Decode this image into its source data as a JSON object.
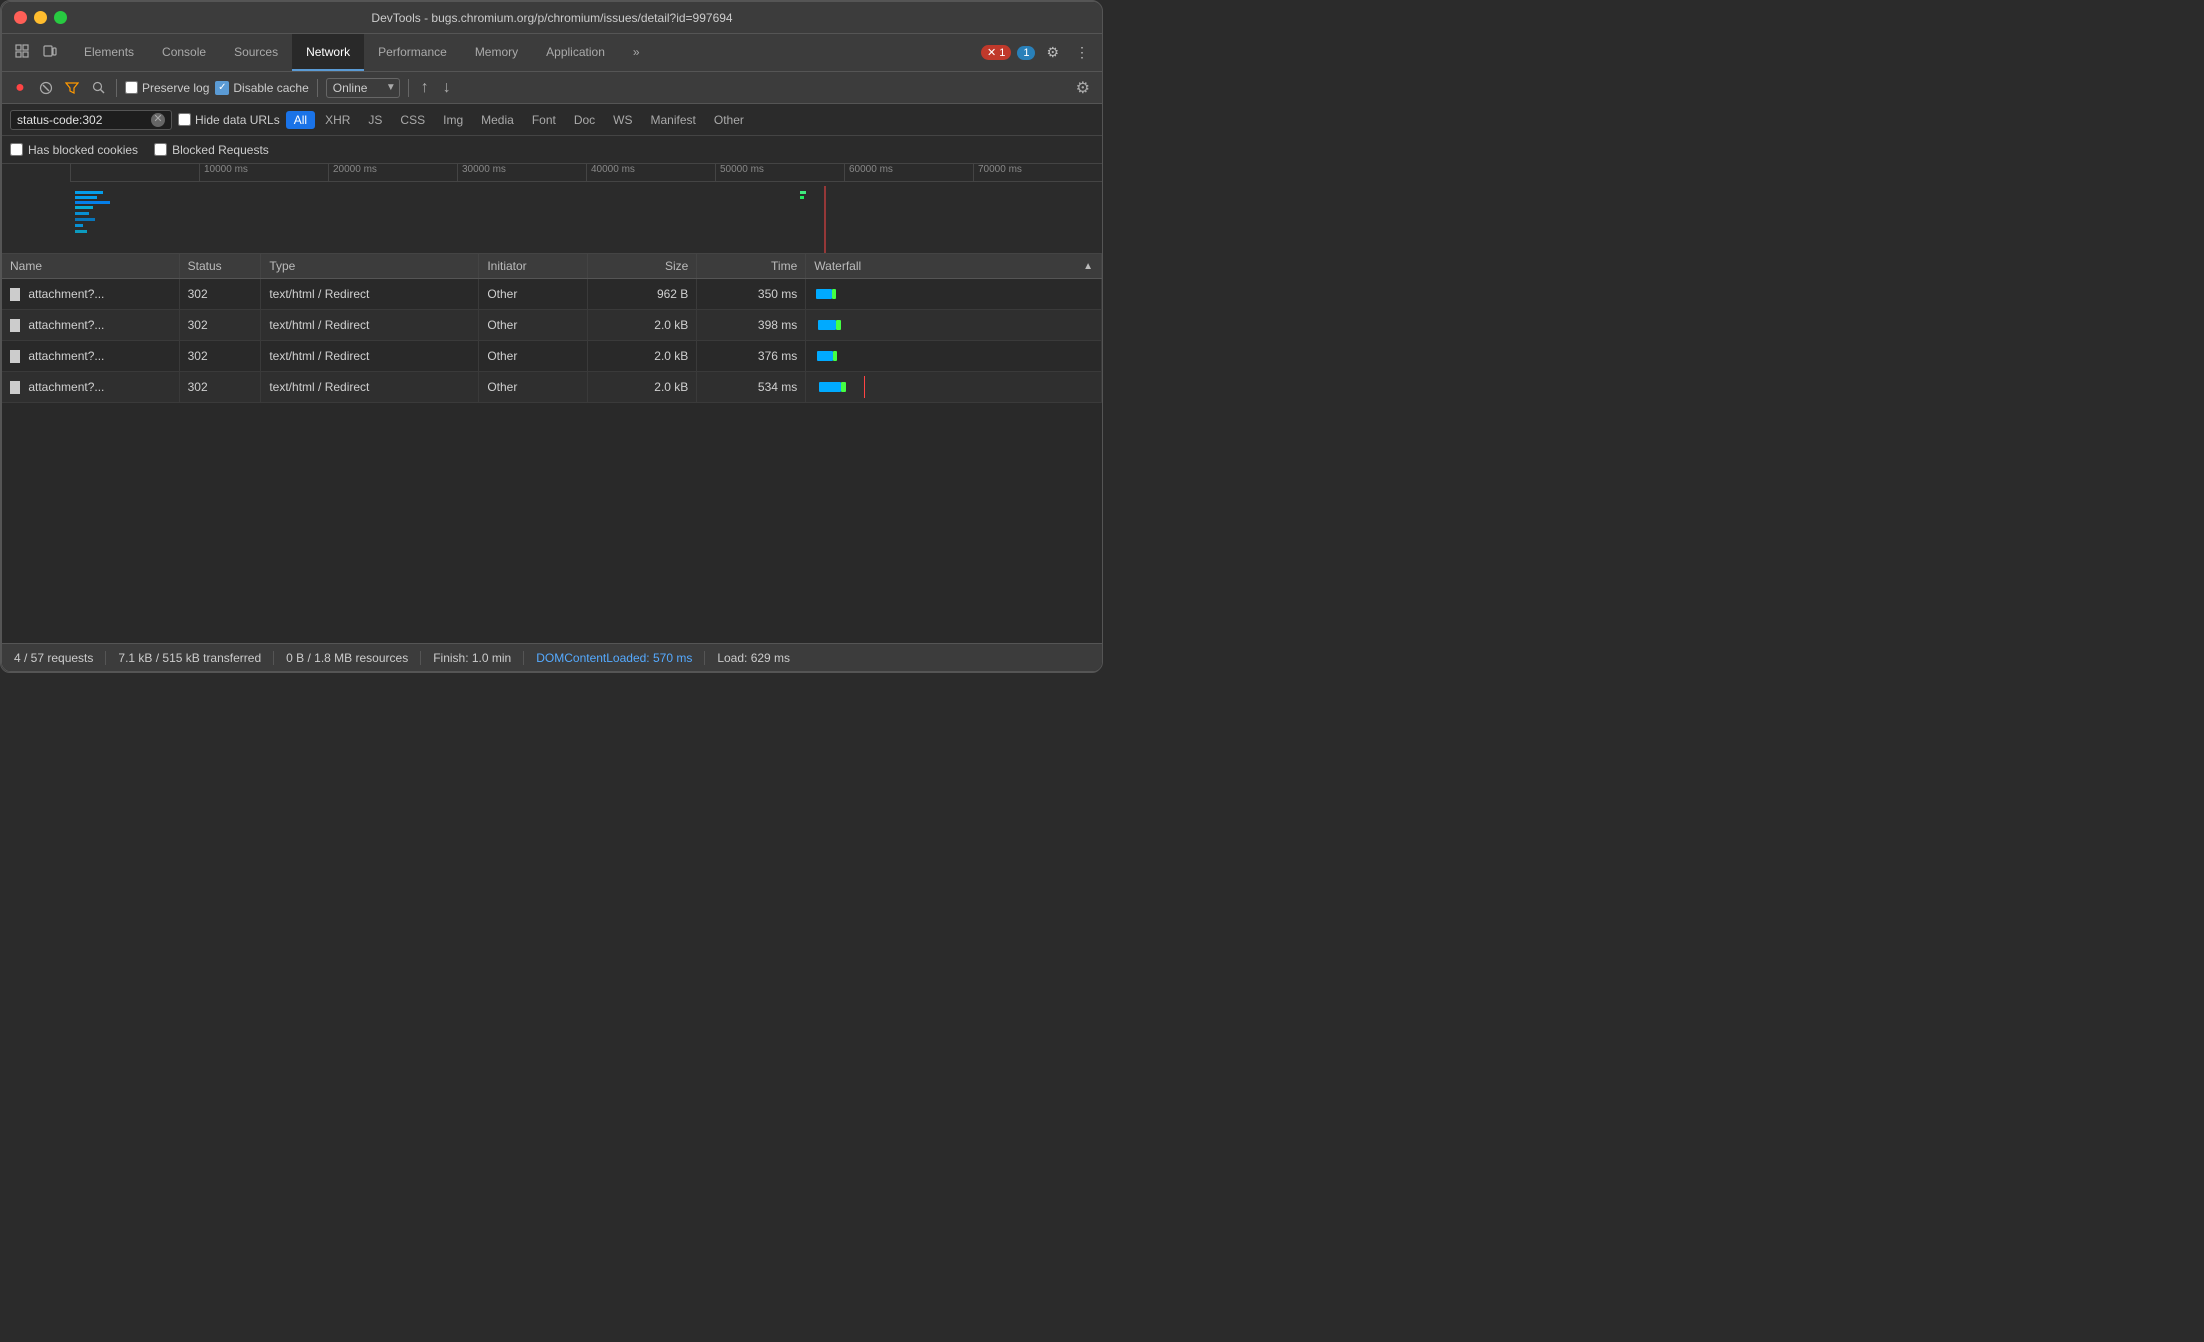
{
  "window": {
    "title": "DevTools - bugs.chromium.org/p/chromium/issues/detail?id=997694"
  },
  "tabs": {
    "items": [
      {
        "label": "Elements",
        "active": false
      },
      {
        "label": "Console",
        "active": false
      },
      {
        "label": "Sources",
        "active": false
      },
      {
        "label": "Network",
        "active": true
      },
      {
        "label": "Performance",
        "active": false
      },
      {
        "label": "Memory",
        "active": false
      },
      {
        "label": "Application",
        "active": false
      }
    ],
    "more": "»",
    "error_count": "1",
    "warning_count": "1"
  },
  "toolbar": {
    "preserve_log": "Preserve log",
    "disable_cache": "Disable cache",
    "online_label": "Online"
  },
  "filter": {
    "value": "status-code:302",
    "hide_data_urls": "Hide data URLs",
    "types": [
      {
        "label": "All",
        "active": true
      },
      {
        "label": "XHR",
        "active": false
      },
      {
        "label": "JS",
        "active": false
      },
      {
        "label": "CSS",
        "active": false
      },
      {
        "label": "Img",
        "active": false
      },
      {
        "label": "Media",
        "active": false
      },
      {
        "label": "Font",
        "active": false
      },
      {
        "label": "Doc",
        "active": false
      },
      {
        "label": "WS",
        "active": false
      },
      {
        "label": "Manifest",
        "active": false
      },
      {
        "label": "Other",
        "active": false
      }
    ]
  },
  "checkboxes": {
    "blocked_cookies": "Has blocked cookies",
    "blocked_requests": "Blocked Requests"
  },
  "timeline": {
    "marks": [
      "10000 ms",
      "20000 ms",
      "30000 ms",
      "40000 ms",
      "50000 ms",
      "60000 ms",
      "70000 ms"
    ]
  },
  "table": {
    "headers": [
      "Name",
      "Status",
      "Type",
      "Initiator",
      "Size",
      "Time",
      "Waterfall"
    ],
    "rows": [
      {
        "name": "attachment?...",
        "status": "302",
        "type": "text/html / Redirect",
        "initiator": "Other",
        "size": "962 B",
        "time": "350 ms"
      },
      {
        "name": "attachment?...",
        "status": "302",
        "type": "text/html / Redirect",
        "initiator": "Other",
        "size": "2.0 kB",
        "time": "398 ms"
      },
      {
        "name": "attachment?...",
        "status": "302",
        "type": "text/html / Redirect",
        "initiator": "Other",
        "size": "2.0 kB",
        "time": "376 ms"
      },
      {
        "name": "attachment?...",
        "status": "302",
        "type": "text/html / Redirect",
        "initiator": "Other",
        "size": "2.0 kB",
        "time": "534 ms"
      }
    ]
  },
  "statusbar": {
    "requests": "4 / 57 requests",
    "transferred": "7.1 kB / 515 kB transferred",
    "resources": "0 B / 1.8 MB resources",
    "finish": "Finish: 1.0 min",
    "dom_content": "DOMContentLoaded: 570 ms",
    "load": "Load: 629 ms"
  }
}
